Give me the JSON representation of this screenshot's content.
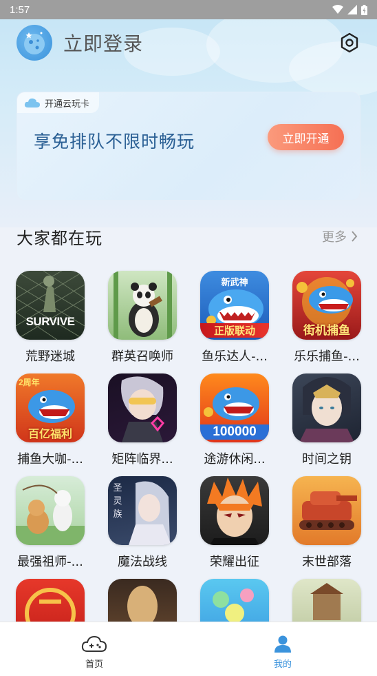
{
  "status_bar": {
    "time": "1:57"
  },
  "header": {
    "login_label": "立即登录"
  },
  "vip_card": {
    "tag": "开通云玩卡",
    "slogan": "享免排队不限时畅玩",
    "button": "立即开通"
  },
  "section": {
    "title": "大家都在玩",
    "more": "更多"
  },
  "games": [
    {
      "name": "荒野迷城",
      "icon_text": "SURVIVE"
    },
    {
      "name": "群英召唤师",
      "icon_text": ""
    },
    {
      "name": "鱼乐达人-...",
      "icon_text": "正版联动",
      "icon_text2": "新武神"
    },
    {
      "name": "乐乐捕鱼-...",
      "icon_text": "街机捕鱼"
    },
    {
      "name": "捕鱼大咖-...",
      "icon_text": "百亿福利",
      "icon_text2": "2周年"
    },
    {
      "name": "矩阵临界...",
      "icon_text": ""
    },
    {
      "name": "途游休闲...",
      "icon_text": "100000"
    },
    {
      "name": "时间之钥",
      "icon_text": ""
    },
    {
      "name": "最强祖师-...",
      "icon_text": ""
    },
    {
      "name": "魔法战线",
      "icon_text": "圣灵族"
    },
    {
      "name": "荣耀出征",
      "icon_text": ""
    },
    {
      "name": "末世部落",
      "icon_text": ""
    },
    {
      "name": "",
      "icon_text": ""
    },
    {
      "name": "",
      "icon_text": ""
    },
    {
      "name": "",
      "icon_text": ""
    },
    {
      "name": "",
      "icon_text": ""
    }
  ],
  "bottom_nav": [
    {
      "label": "首页",
      "icon": "gamepad-cloud-icon",
      "active": false
    },
    {
      "label": "我的",
      "icon": "user-icon",
      "active": true
    }
  ],
  "colors": {
    "accent": "#3b93dc",
    "button": "#f67054",
    "slogan": "#2a5f94"
  }
}
